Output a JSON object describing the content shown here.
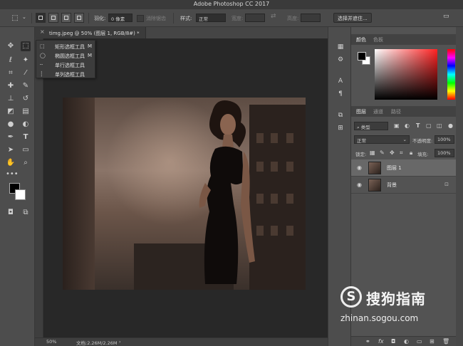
{
  "app": {
    "title": "Adobe Photoshop CC 2017"
  },
  "options_bar": {
    "feather_label": "羽化:",
    "feather_value": "0 像素",
    "antialias_label": "消除锯齿",
    "style_label": "样式:",
    "style_value": "正常",
    "width_label": "宽度:",
    "height_label": "高度:",
    "select_mask_button": "选择并遮住..."
  },
  "document": {
    "tab_title": "timg.jpeg @ 50% (图层 1, RGB/8#) *",
    "tab_close": "×",
    "zoom": "50%",
    "doc_size": "文档:2.26M/2.26M"
  },
  "flyout": {
    "items": [
      {
        "label": "矩形选框工具",
        "key": "M"
      },
      {
        "label": "椭圆选框工具",
        "key": "M"
      },
      {
        "label": "单行选框工具",
        "key": ""
      },
      {
        "label": "单列选框工具",
        "key": ""
      }
    ]
  },
  "color_panel": {
    "tabs": [
      "颜色",
      "色板"
    ],
    "fg_color": "#000000",
    "bg_color": "#ffffff"
  },
  "layers_panel": {
    "tabs": [
      "图层",
      "通道",
      "路径"
    ],
    "filter_kind": "类型",
    "blend_mode": "正常",
    "opacity_label": "不透明度:",
    "opacity_value": "100%",
    "lock_label": "锁定:",
    "fill_label": "填充:",
    "fill_value": "100%",
    "layers": [
      {
        "name": "图层 1",
        "selected": true
      },
      {
        "name": "背景",
        "selected": false,
        "locked": true
      }
    ],
    "footer_icons": [
      "link-icon",
      "fx-icon",
      "mask-icon",
      "adjustment-icon",
      "folder-icon",
      "new-layer-icon",
      "trash-icon"
    ],
    "footer_fx": "fx"
  },
  "watermark": {
    "name": "搜狗指南",
    "url": "zhinan.sogou.com"
  }
}
